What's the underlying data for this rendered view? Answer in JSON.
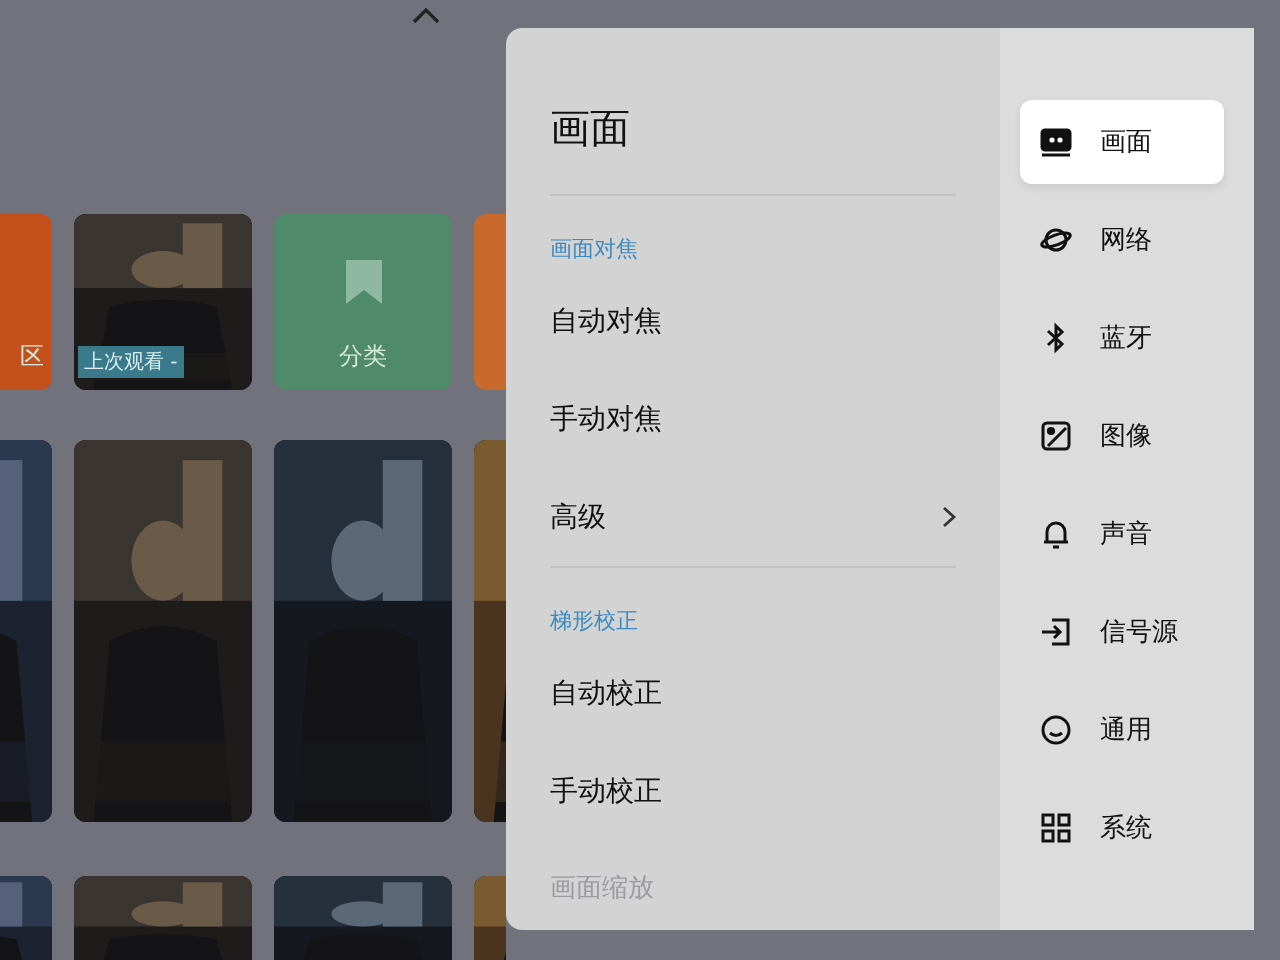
{
  "home": {
    "rows": [
      {
        "tiles": [
          {
            "kind": "category",
            "label": "区",
            "color": "#c4501c"
          },
          {
            "kind": "picture",
            "badge": "上次观看 -"
          },
          {
            "kind": "category",
            "label": "分类",
            "color": "#4f8a6a"
          },
          {
            "kind": "category",
            "color": "#c86a2c"
          }
        ]
      },
      {
        "tiles": [
          {
            "kind": "picture"
          },
          {
            "kind": "picture"
          },
          {
            "kind": "picture"
          },
          {
            "kind": "picture"
          }
        ]
      },
      {
        "tiles": [
          {
            "kind": "picture"
          },
          {
            "kind": "picture"
          },
          {
            "kind": "picture"
          },
          {
            "kind": "picture"
          }
        ]
      }
    ]
  },
  "settings": {
    "title": "画面",
    "sections": [
      {
        "heading": "画面对焦",
        "items": [
          {
            "label": "自动对焦",
            "submenu": false
          },
          {
            "label": "手动对焦",
            "submenu": false
          },
          {
            "label": "高级",
            "submenu": true
          }
        ]
      },
      {
        "heading": "梯形校正",
        "items": [
          {
            "label": "自动校正",
            "submenu": false
          },
          {
            "label": "手动校正",
            "submenu": false
          }
        ]
      },
      {
        "heading": "画面缩放"
      }
    ]
  },
  "sidebar": {
    "items": [
      {
        "label": "画面",
        "selected": true
      },
      {
        "label": "网络",
        "selected": false
      },
      {
        "label": "蓝牙",
        "selected": false
      },
      {
        "label": "图像",
        "selected": false
      },
      {
        "label": "声音",
        "selected": false
      },
      {
        "label": "信号源",
        "selected": false
      },
      {
        "label": "通用",
        "selected": false
      },
      {
        "label": "系统",
        "selected": false
      }
    ]
  }
}
